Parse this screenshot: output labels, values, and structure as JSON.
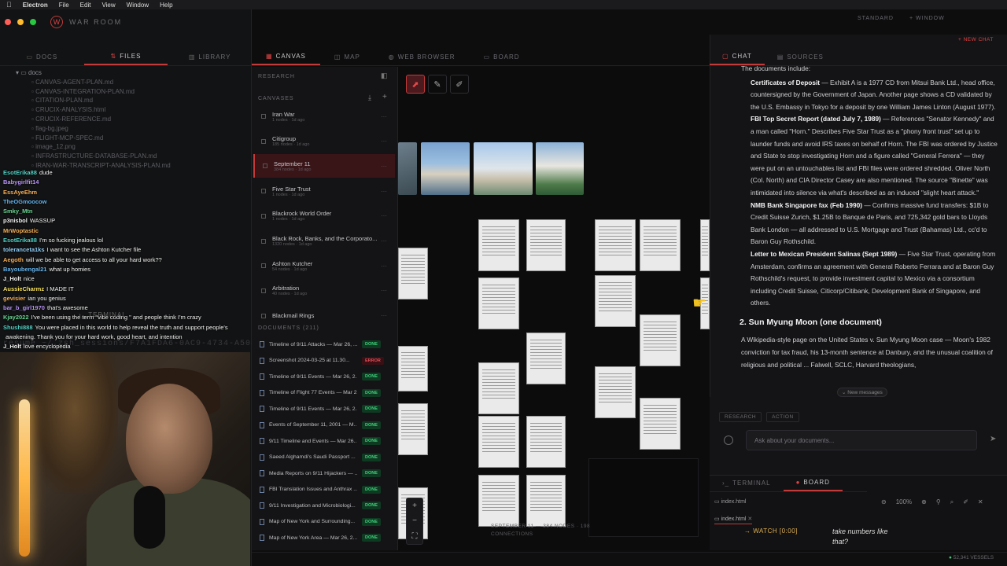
{
  "menubar": {
    "apple": "",
    "items": [
      "Electron",
      "File",
      "Edit",
      "View",
      "Window",
      "Help"
    ]
  },
  "app": {
    "logo": "W",
    "title": "WAR ROOM"
  },
  "top_right": {
    "standard": "STANDARD",
    "window": "+ WINDOW",
    "new_chat": "+ NEW CHAT"
  },
  "left_tabs": [
    "DOCS",
    "FILES",
    "LIBRARY"
  ],
  "file_tree": [
    "docs",
    "CANVAS-AGENT-PLAN.md",
    "CANVAS-INTEGRATION-PLAN.md",
    "CITATION-PLAN.md",
    "CRUCIX-ANALYSIS.html",
    "CRUCIX-REFERENCE.md",
    "flag-bg.jpeg",
    "FLIGHT-MCP-SPEC.md",
    "image_12.png",
    "INFRASTRUCTURE-DATABASE-PLAN.md",
    "IRAN-WAR-TRANSCRIPT-ANALYSIS-PLAN.md"
  ],
  "chat_messages": [
    {
      "user": "EsotErika88",
      "color": "#4fd1c5",
      "text": "dude"
    },
    {
      "user": "Babygirlfit14",
      "color": "#b794f4",
      "text": ""
    },
    {
      "user": "EssAyeEhm",
      "color": "#f6ad55",
      "text": ""
    },
    {
      "user": "TheOGmoocow",
      "color": "#63b3ed",
      "text": ""
    },
    {
      "user": "Smky_Mtn",
      "color": "#68d391",
      "text": ""
    },
    {
      "user": "p3nisbol",
      "color": "#f0f0f0",
      "text": "WASSUP"
    },
    {
      "user": "MrWoptastic",
      "color": "#f6ad55",
      "text": ""
    },
    {
      "user": "EsotErika88",
      "color": "#4fd1c5",
      "text": "I'm so fucking jealous lol"
    },
    {
      "user": "toleranceta1ks",
      "color": "#90cdf4",
      "text": "I want to see the Ashton Kutcher file"
    },
    {
      "user": "Aegoth",
      "color": "#f6ad55",
      "text": "will we be able to get access to all your hard work??"
    },
    {
      "user": "Bayoubengal21",
      "color": "#63b3ed",
      "text": "what up homies"
    },
    {
      "user": "J_Holt",
      "color": "#f0f0f0",
      "text": "nice"
    },
    {
      "user": "AussieCharmz",
      "color": "#f6e05e",
      "text": "I MADE IT"
    },
    {
      "user": "gevisier",
      "color": "#f6ad55",
      "text": "ian you genius"
    },
    {
      "user": "bar_b_girl1970",
      "color": "#b794f4",
      "text": "that's awesome"
    },
    {
      "user": "Kjay2022",
      "color": "#68d391",
      "text": "I've been using the term \"vibe coding \" and people think I'm crazy"
    },
    {
      "user": "Shushi888",
      "color": "#4fd1c5",
      "text": "You were placed in this world to help reveal the truth and support people's"
    },
    {
      "user": "",
      "color": "#f0f0f0",
      "text": "awakening. Thank you for your hard work, good heart, and intention"
    },
    {
      "user": "J_Holt",
      "color": "#f0f0f0",
      "text": "love encyclopedia"
    }
  ],
  "terminal": {
    "label": "TERMINAL",
    "line": "resume ~/.zsh_sessions/F7A1FDA6-0AC9-4734-A508-3E"
  },
  "center_tabs": [
    "CANVAS",
    "MAP",
    "WEB BROWSER",
    "BOARD"
  ],
  "research": {
    "header": "RESEARCH",
    "canvases_label": "CANVASES",
    "canvases": [
      {
        "name": "Iran War",
        "sub": "1 nodes · 1d ago"
      },
      {
        "name": "Citigroup",
        "sub": "185 nodes · 1d ago"
      },
      {
        "name": "September 11",
        "sub": "384 nodes · 1d ago"
      },
      {
        "name": "Five Star Trust",
        "sub": "1 nodes · 1d ago"
      },
      {
        "name": "Blackrock World Order",
        "sub": "1 nodes · 1d ago"
      },
      {
        "name": "Black Rock, Banks, and the Corporato...",
        "sub": "1320 nodes · 1d ago"
      },
      {
        "name": "Ashton Kutcher",
        "sub": "54 nodes · 1d ago"
      },
      {
        "name": "Arbitration",
        "sub": "40 nodes · 1d ago"
      },
      {
        "name": "Blackmail Rings",
        "sub": ""
      }
    ],
    "documents_label": "DOCUMENTS (211)",
    "documents": [
      {
        "name": "Timeline of 9/11 Attacks — Mar 26, ...",
        "status": "DONE"
      },
      {
        "name": "Screenshot 2024-03-25 at 11.30...",
        "status": "ERROR"
      },
      {
        "name": "Timeline of 9/11 Events — Mar 26, 2...",
        "status": "DONE"
      },
      {
        "name": "Timeline of Flight 77 Events — Mar 2...",
        "status": "DONE"
      },
      {
        "name": "Timeline of 9/11 Events — Mar 26, 2...",
        "status": "DONE"
      },
      {
        "name": "Events of September 11, 2001 — M...",
        "status": "DONE"
      },
      {
        "name": "9/11 Timeline and Events — Mar 26...",
        "status": "DONE"
      },
      {
        "name": "Saeed Alghamdi's Saudi Passport ...",
        "status": "DONE"
      },
      {
        "name": "Media Reports on 9/11 Hijackers — ...",
        "status": "DONE"
      },
      {
        "name": "FBI Translation Issues and Anthrax ...",
        "status": "DONE"
      },
      {
        "name": "9/11 Investigation and Microbiologi...",
        "status": "DONE"
      },
      {
        "name": "Map of New York and Surrounding...",
        "status": "DONE"
      },
      {
        "name": "Map of New York Area — Mar 26, 2...",
        "status": "DONE"
      }
    ]
  },
  "canvas": {
    "status_line": "SEPTEMBER 11 — 384 NODES · 198 CONNECTIONS"
  },
  "right_tabs": [
    "CHAT",
    "SOURCES"
  ],
  "chat_body": {
    "intro": "The documents include:",
    "items": [
      {
        "bold": "Certificates of Deposit",
        "text": " — Exhibit A is a 1977 CD from Mitsui Bank Ltd., head office, countersigned by the Government of Japan. Another page shows a CD validated by the U.S. Embassy in Tokyo for a deposit by one William James Linton (August 1977)."
      },
      {
        "bold": "FBI Top Secret Report (dated July 7, 1989)",
        "text": " — References \"Senator Kennedy\" and a man called \"Horn.\" Describes Five Star Trust as a \"phony front trust\" set up to launder funds and avoid IRS taxes on behalf of Horn. The FBI was ordered by Justice and State to stop investigating Horn and a figure called \"General Ferrera\" — they were put on an untouchables list and FBI files were ordered shredded. Oliver North (Col. North) and CIA Director Casey are also mentioned. The source \"Binette\" was intimidated into silence via what's described as an induced \"slight heart attack.\""
      },
      {
        "bold": "NMB Bank Singapore fax (Feb 1990)",
        "text": " — Confirms massive fund transfers: $1B to Credit Suisse Zurich, $1.25B to Banque de Paris, and 725,342 gold bars to Lloyds Bank London — all addressed to U.S. Mortgage and Trust (Bahamas) Ltd., cc'd to Baron Guy Rothschild."
      },
      {
        "bold": "Letter to Mexican President Salinas (Sept 1989)",
        "text": " — Five Star Trust, operating from Amsterdam, confirms an agreement with General Roberto Ferrara and at Baron Guy Rothschild's request, to provide investment capital to Mexico via a consortium including Credit Suisse, Citicorp/Citibank, Development Bank of Singapore, and others."
      }
    ],
    "heading2": "2. Sun Myung Moon (one document)",
    "para2": "A Wikipedia-style page on the United States v. Sun Myung Moon case — Moon's 1982 conviction for tax fraud, his 13-month sentence at Danbury, and the unusual coalition of religious and political ... Falwell, SCLC, Harvard theologians,"
  },
  "new_messages": "New messages",
  "mode_tabs": [
    "RESEARCH",
    "ACTION"
  ],
  "chat_input": {
    "placeholder": "Ask about your documents..."
  },
  "bottom_right": {
    "tabs": [
      "TERMINAL",
      "BOARD"
    ],
    "file": "index.html",
    "zoom": "100%",
    "file_tab": "index.html",
    "watch": "→ WATCH [0:00]",
    "note": "take numbers like that?"
  },
  "status": {
    "vessels": "52,341 VESSELS"
  }
}
